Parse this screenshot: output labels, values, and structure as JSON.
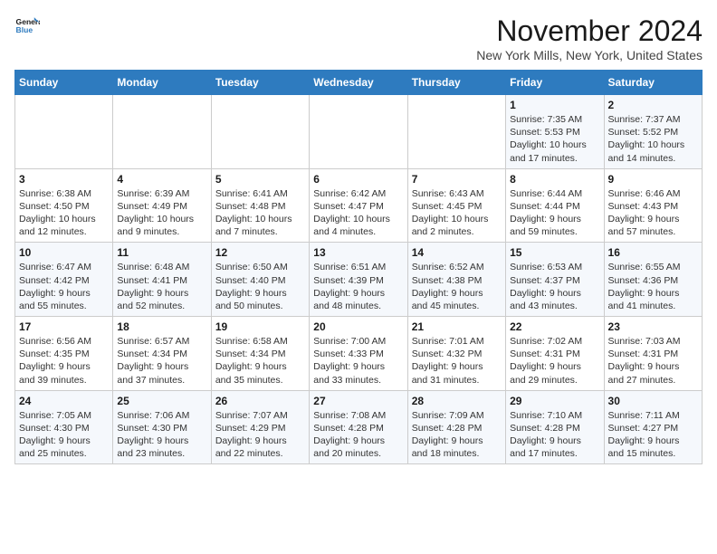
{
  "header": {
    "logo_line1": "General",
    "logo_line2": "Blue",
    "month": "November 2024",
    "location": "New York Mills, New York, United States"
  },
  "weekdays": [
    "Sunday",
    "Monday",
    "Tuesday",
    "Wednesday",
    "Thursday",
    "Friday",
    "Saturday"
  ],
  "weeks": [
    [
      {
        "day": "",
        "info": ""
      },
      {
        "day": "",
        "info": ""
      },
      {
        "day": "",
        "info": ""
      },
      {
        "day": "",
        "info": ""
      },
      {
        "day": "",
        "info": ""
      },
      {
        "day": "1",
        "info": "Sunrise: 7:35 AM\nSunset: 5:53 PM\nDaylight: 10 hours\nand 17 minutes."
      },
      {
        "day": "2",
        "info": "Sunrise: 7:37 AM\nSunset: 5:52 PM\nDaylight: 10 hours\nand 14 minutes."
      }
    ],
    [
      {
        "day": "3",
        "info": "Sunrise: 6:38 AM\nSunset: 4:50 PM\nDaylight: 10 hours\nand 12 minutes."
      },
      {
        "day": "4",
        "info": "Sunrise: 6:39 AM\nSunset: 4:49 PM\nDaylight: 10 hours\nand 9 minutes."
      },
      {
        "day": "5",
        "info": "Sunrise: 6:41 AM\nSunset: 4:48 PM\nDaylight: 10 hours\nand 7 minutes."
      },
      {
        "day": "6",
        "info": "Sunrise: 6:42 AM\nSunset: 4:47 PM\nDaylight: 10 hours\nand 4 minutes."
      },
      {
        "day": "7",
        "info": "Sunrise: 6:43 AM\nSunset: 4:45 PM\nDaylight: 10 hours\nand 2 minutes."
      },
      {
        "day": "8",
        "info": "Sunrise: 6:44 AM\nSunset: 4:44 PM\nDaylight: 9 hours\nand 59 minutes."
      },
      {
        "day": "9",
        "info": "Sunrise: 6:46 AM\nSunset: 4:43 PM\nDaylight: 9 hours\nand 57 minutes."
      }
    ],
    [
      {
        "day": "10",
        "info": "Sunrise: 6:47 AM\nSunset: 4:42 PM\nDaylight: 9 hours\nand 55 minutes."
      },
      {
        "day": "11",
        "info": "Sunrise: 6:48 AM\nSunset: 4:41 PM\nDaylight: 9 hours\nand 52 minutes."
      },
      {
        "day": "12",
        "info": "Sunrise: 6:50 AM\nSunset: 4:40 PM\nDaylight: 9 hours\nand 50 minutes."
      },
      {
        "day": "13",
        "info": "Sunrise: 6:51 AM\nSunset: 4:39 PM\nDaylight: 9 hours\nand 48 minutes."
      },
      {
        "day": "14",
        "info": "Sunrise: 6:52 AM\nSunset: 4:38 PM\nDaylight: 9 hours\nand 45 minutes."
      },
      {
        "day": "15",
        "info": "Sunrise: 6:53 AM\nSunset: 4:37 PM\nDaylight: 9 hours\nand 43 minutes."
      },
      {
        "day": "16",
        "info": "Sunrise: 6:55 AM\nSunset: 4:36 PM\nDaylight: 9 hours\nand 41 minutes."
      }
    ],
    [
      {
        "day": "17",
        "info": "Sunrise: 6:56 AM\nSunset: 4:35 PM\nDaylight: 9 hours\nand 39 minutes."
      },
      {
        "day": "18",
        "info": "Sunrise: 6:57 AM\nSunset: 4:34 PM\nDaylight: 9 hours\nand 37 minutes."
      },
      {
        "day": "19",
        "info": "Sunrise: 6:58 AM\nSunset: 4:34 PM\nDaylight: 9 hours\nand 35 minutes."
      },
      {
        "day": "20",
        "info": "Sunrise: 7:00 AM\nSunset: 4:33 PM\nDaylight: 9 hours\nand 33 minutes."
      },
      {
        "day": "21",
        "info": "Sunrise: 7:01 AM\nSunset: 4:32 PM\nDaylight: 9 hours\nand 31 minutes."
      },
      {
        "day": "22",
        "info": "Sunrise: 7:02 AM\nSunset: 4:31 PM\nDaylight: 9 hours\nand 29 minutes."
      },
      {
        "day": "23",
        "info": "Sunrise: 7:03 AM\nSunset: 4:31 PM\nDaylight: 9 hours\nand 27 minutes."
      }
    ],
    [
      {
        "day": "24",
        "info": "Sunrise: 7:05 AM\nSunset: 4:30 PM\nDaylight: 9 hours\nand 25 minutes."
      },
      {
        "day": "25",
        "info": "Sunrise: 7:06 AM\nSunset: 4:30 PM\nDaylight: 9 hours\nand 23 minutes."
      },
      {
        "day": "26",
        "info": "Sunrise: 7:07 AM\nSunset: 4:29 PM\nDaylight: 9 hours\nand 22 minutes."
      },
      {
        "day": "27",
        "info": "Sunrise: 7:08 AM\nSunset: 4:28 PM\nDaylight: 9 hours\nand 20 minutes."
      },
      {
        "day": "28",
        "info": "Sunrise: 7:09 AM\nSunset: 4:28 PM\nDaylight: 9 hours\nand 18 minutes."
      },
      {
        "day": "29",
        "info": "Sunrise: 7:10 AM\nSunset: 4:28 PM\nDaylight: 9 hours\nand 17 minutes."
      },
      {
        "day": "30",
        "info": "Sunrise: 7:11 AM\nSunset: 4:27 PM\nDaylight: 9 hours\nand 15 minutes."
      }
    ]
  ]
}
